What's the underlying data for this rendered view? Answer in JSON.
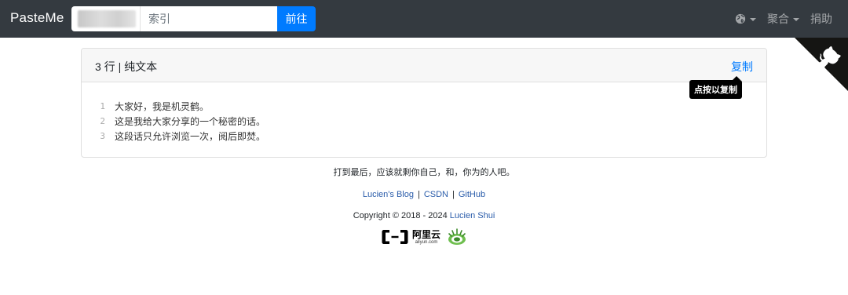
{
  "navbar": {
    "brand": "PasteMe",
    "search": {
      "placeholder": "索引"
    },
    "go_label": "前往",
    "menu": {
      "aggregate": "聚合",
      "donate": "捐助"
    }
  },
  "paste": {
    "title": "3 行 | 纯文本",
    "copy_label": "复制",
    "tooltip": "点按以复制",
    "lines": [
      {
        "no": "1",
        "text": "大家好，我是机灵鹤。"
      },
      {
        "no": "2",
        "text": "这是我给大家分享的一个秘密的话。"
      },
      {
        "no": "3",
        "text": "这段话只允许浏览一次，阅后即焚。"
      }
    ]
  },
  "footer": {
    "tagline": "打到最后，应该就剩你自己，和，你为的人吧。",
    "links": [
      "Lucien's Blog",
      "CSDN",
      "GitHub"
    ],
    "separator": "|",
    "copyright_prefix": "Copyright © 2018 - 2024",
    "author": "Lucien Shui",
    "aliyun_cn": "阿里云",
    "aliyun_en": "aliyun.com"
  },
  "colors": {
    "navbar_bg": "#343a40",
    "primary": "#007bff",
    "link": "#2a5caa"
  },
  "icons": {
    "nav_globe": "globe-icon",
    "corner": "github-octocat-icon",
    "aliyun": "aliyun-logo",
    "badge": "security-badge-icon"
  }
}
